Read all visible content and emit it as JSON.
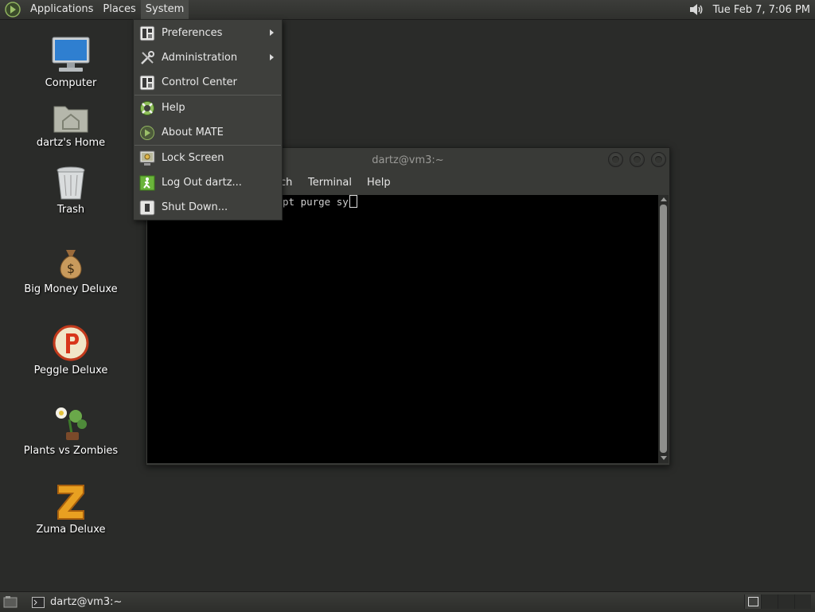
{
  "top_panel": {
    "menus": [
      "Applications",
      "Places",
      "System"
    ],
    "clock": "Tue Feb  7,  7:06 PM",
    "logo_icon": "mate-logo-icon",
    "sound_icon": "speaker-icon"
  },
  "desktop": {
    "icons": [
      {
        "label": "Computer",
        "icon": "computer-icon"
      },
      {
        "label": "dartz's Home",
        "icon": "home-folder-icon"
      },
      {
        "label": "Trash",
        "icon": "trash-icon"
      },
      {
        "label": "Big Money Deluxe",
        "icon": "money-bag-icon"
      },
      {
        "label": "Peggle Deluxe",
        "icon": "peggle-icon"
      },
      {
        "label": "Plants vs Zombies",
        "icon": "plants-vs-zombies-icon"
      },
      {
        "label": "Zuma Deluxe",
        "icon": "zuma-icon"
      }
    ]
  },
  "terminal": {
    "title": "dartz@vm3:~",
    "menus": [
      "ch",
      "Terminal",
      "Help"
    ],
    "content": "pt purge sy"
  },
  "system_menu": {
    "items": [
      {
        "label": "Preferences",
        "icon": "preferences-icon",
        "submenu": true
      },
      {
        "label": "Administration",
        "icon": "administration-icon",
        "submenu": true
      },
      {
        "label": "Control Center",
        "icon": "control-center-icon",
        "submenu": false
      },
      {
        "label": "Help",
        "icon": "help-lifebuoy-icon",
        "submenu": false
      },
      {
        "label": "About MATE",
        "icon": "mate-about-icon",
        "submenu": false
      },
      {
        "label": "Lock Screen",
        "icon": "lock-screen-icon",
        "submenu": false
      },
      {
        "label": "Log Out dartz...",
        "icon": "log-out-icon",
        "submenu": false
      },
      {
        "label": "Shut Down...",
        "icon": "shut-down-icon",
        "submenu": false
      }
    ]
  },
  "bottom_panel": {
    "task": "dartz@vm3:~",
    "show_desktop_icon": "show-desktop-icon",
    "workspaces": 4
  }
}
